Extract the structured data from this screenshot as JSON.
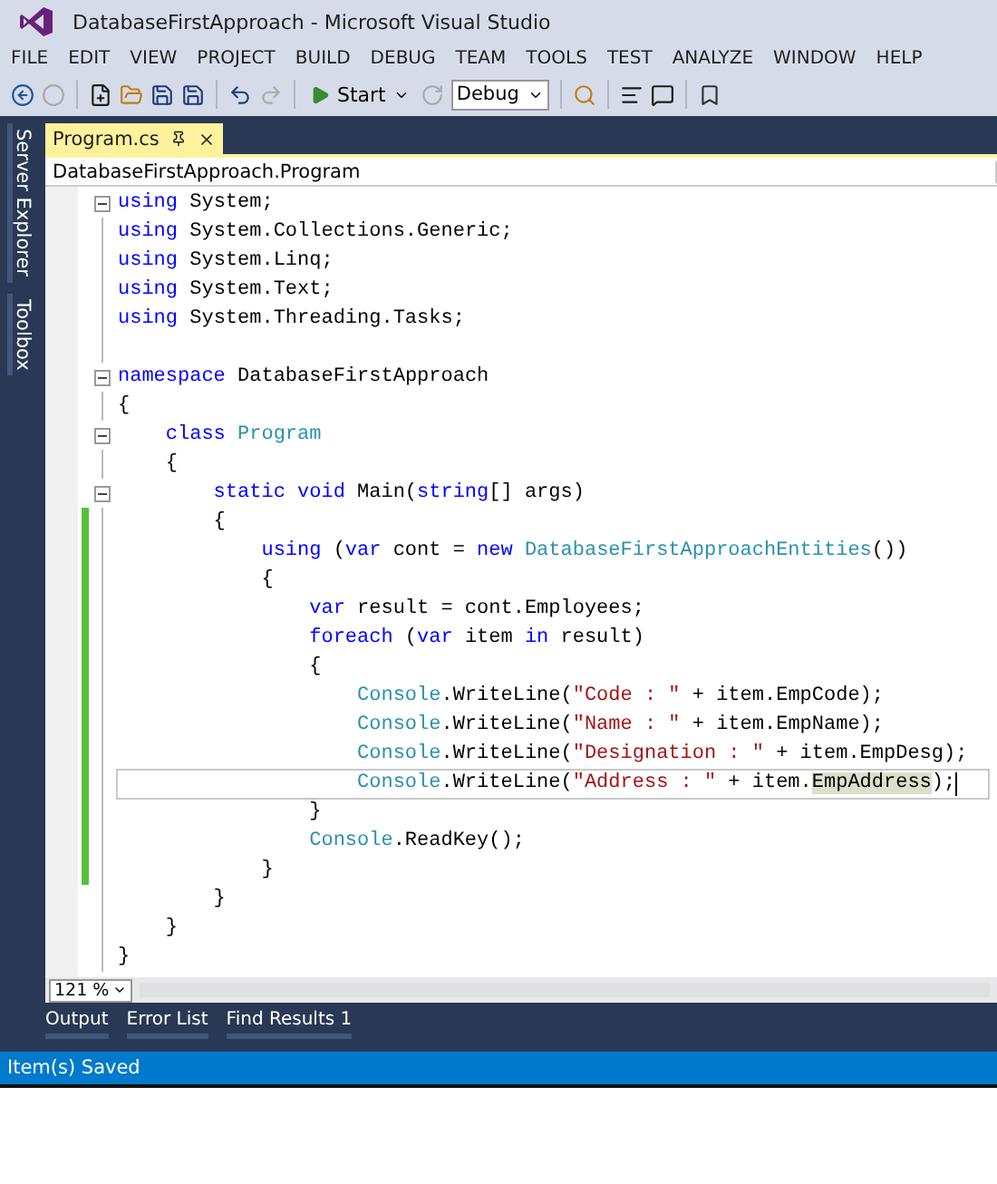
{
  "window": {
    "title": "DatabaseFirstApproach - Microsoft Visual Studio"
  },
  "menu": [
    {
      "label": "FILE"
    },
    {
      "label": "EDIT"
    },
    {
      "label": "VIEW"
    },
    {
      "label": "PROJECT"
    },
    {
      "label": "BUILD"
    },
    {
      "label": "DEBUG"
    },
    {
      "label": "TEAM"
    },
    {
      "label": "TOOLS"
    },
    {
      "label": "TEST"
    },
    {
      "label": "ANALYZE"
    },
    {
      "label": "WINDOW"
    },
    {
      "label": "HELP"
    }
  ],
  "toolbar": {
    "start_label": "Start",
    "configuration": "Debug"
  },
  "side_tabs": [
    {
      "label": "Server Explorer"
    },
    {
      "label": "Toolbox"
    }
  ],
  "document_tabs": [
    {
      "label": "Program.cs",
      "selected": true
    }
  ],
  "navigation": {
    "scope": "DatabaseFirstApproach.Program"
  },
  "code_lines": [
    {
      "fold": true,
      "changed": false,
      "current": false,
      "tokens": [
        {
          "kind": "kw",
          "text": "using"
        },
        {
          "kind": "plain",
          "text": " System;"
        }
      ]
    },
    {
      "fold": false,
      "changed": false,
      "current": false,
      "tokens": [
        {
          "kind": "kw",
          "text": "using"
        },
        {
          "kind": "plain",
          "text": " System.Collections.Generic;"
        }
      ]
    },
    {
      "fold": false,
      "changed": false,
      "current": false,
      "tokens": [
        {
          "kind": "kw",
          "text": "using"
        },
        {
          "kind": "plain",
          "text": " System.Linq;"
        }
      ]
    },
    {
      "fold": false,
      "changed": false,
      "current": false,
      "tokens": [
        {
          "kind": "kw",
          "text": "using"
        },
        {
          "kind": "plain",
          "text": " System.Text;"
        }
      ]
    },
    {
      "fold": false,
      "changed": false,
      "current": false,
      "tokens": [
        {
          "kind": "kw",
          "text": "using"
        },
        {
          "kind": "plain",
          "text": " System.Threading.Tasks;"
        }
      ]
    },
    {
      "fold": false,
      "changed": false,
      "current": false
    },
    {
      "fold": true,
      "changed": false,
      "current": false,
      "tokens": [
        {
          "kind": "kw",
          "text": "namespace"
        },
        {
          "kind": "plain",
          "text": " DatabaseFirstApproach"
        }
      ]
    },
    {
      "fold": false,
      "changed": false,
      "current": false,
      "tokens": [
        {
          "kind": "plain",
          "text": "{"
        }
      ]
    },
    {
      "fold": true,
      "changed": false,
      "current": false,
      "tokens": [
        {
          "kind": "kw",
          "text": "    class"
        },
        {
          "kind": "type",
          "text": " Program"
        }
      ]
    },
    {
      "fold": false,
      "changed": false,
      "current": false,
      "tokens": [
        {
          "kind": "plain",
          "text": "    {"
        }
      ]
    },
    {
      "fold": true,
      "changed": false,
      "current": false,
      "tokens": [
        {
          "kind": "kw",
          "text": "        static void"
        },
        {
          "kind": "plain",
          "text": " Main("
        },
        {
          "kind": "kw",
          "text": "string"
        },
        {
          "kind": "plain",
          "text": "[] args)"
        }
      ]
    },
    {
      "fold": false,
      "changed": true,
      "current": false,
      "tokens": [
        {
          "kind": "plain",
          "text": "        {"
        }
      ]
    },
    {
      "fold": false,
      "changed": true,
      "current": false,
      "tokens": [
        {
          "kind": "kw",
          "text": "            using"
        },
        {
          "kind": "plain",
          "text": " ("
        },
        {
          "kind": "kw",
          "text": "var"
        },
        {
          "kind": "plain",
          "text": " cont = "
        },
        {
          "kind": "kw",
          "text": "new"
        },
        {
          "kind": "type",
          "text": " DatabaseFirstApproachEntities"
        },
        {
          "kind": "plain",
          "text": "())"
        }
      ]
    },
    {
      "fold": false,
      "changed": true,
      "current": false,
      "tokens": [
        {
          "kind": "plain",
          "text": "            {"
        }
      ]
    },
    {
      "fold": false,
      "changed": true,
      "current": false,
      "tokens": [
        {
          "kind": "kw",
          "text": "                var"
        },
        {
          "kind": "plain",
          "text": " result = cont.Employees;"
        }
      ]
    },
    {
      "fold": false,
      "changed": true,
      "current": false,
      "tokens": [
        {
          "kind": "kw",
          "text": "                foreach"
        },
        {
          "kind": "plain",
          "text": " ("
        },
        {
          "kind": "kw",
          "text": "var"
        },
        {
          "kind": "plain",
          "text": " item "
        },
        {
          "kind": "kw",
          "text": "in"
        },
        {
          "kind": "plain",
          "text": " result)"
        }
      ]
    },
    {
      "fold": false,
      "changed": true,
      "current": false,
      "tokens": [
        {
          "kind": "plain",
          "text": "                {"
        }
      ]
    },
    {
      "fold": false,
      "changed": true,
      "current": false,
      "tokens": [
        {
          "kind": "type",
          "text": "                    Console"
        },
        {
          "kind": "plain",
          "text": ".WriteLine("
        },
        {
          "kind": "str",
          "text": "\"Code : \""
        },
        {
          "kind": "plain",
          "text": " + item.EmpCode);"
        }
      ]
    },
    {
      "fold": false,
      "changed": true,
      "current": false,
      "tokens": [
        {
          "kind": "type",
          "text": "                    Console"
        },
        {
          "kind": "plain",
          "text": ".WriteLine("
        },
        {
          "kind": "str",
          "text": "\"Name : \""
        },
        {
          "kind": "plain",
          "text": " + item.EmpName);"
        }
      ]
    },
    {
      "fold": false,
      "changed": true,
      "current": false,
      "tokens": [
        {
          "kind": "type",
          "text": "                    Console"
        },
        {
          "kind": "plain",
          "text": ".WriteLine("
        },
        {
          "kind": "str",
          "text": "\"Designation : \""
        },
        {
          "kind": "plain",
          "text": " + item.EmpDesg);"
        }
      ]
    },
    {
      "fold": false,
      "changed": true,
      "current": true,
      "tokens": [
        {
          "kind": "type",
          "text": "                    Console"
        },
        {
          "kind": "plain",
          "text": ".WriteLine("
        },
        {
          "kind": "str",
          "text": "\"Address : \""
        },
        {
          "kind": "plain",
          "text": " + item."
        },
        {
          "kind": "ref",
          "text": "EmpAddress"
        },
        {
          "kind": "plain",
          "text": ");"
        }
      ]
    },
    {
      "fold": false,
      "changed": true,
      "current": false,
      "tokens": [
        {
          "kind": "plain",
          "text": "                }"
        }
      ]
    },
    {
      "fold": false,
      "changed": true,
      "current": false,
      "tokens": [
        {
          "kind": "type",
          "text": "                Console"
        },
        {
          "kind": "plain",
          "text": ".ReadKey();"
        }
      ]
    },
    {
      "fold": false,
      "changed": true,
      "current": false,
      "tokens": [
        {
          "kind": "plain",
          "text": "            }"
        }
      ]
    },
    {
      "fold": false,
      "changed": false,
      "current": false,
      "tokens": [
        {
          "kind": "plain",
          "text": "        }"
        }
      ]
    },
    {
      "fold": false,
      "changed": false,
      "current": false,
      "tokens": [
        {
          "kind": "plain",
          "text": "    }"
        }
      ]
    },
    {
      "fold": false,
      "changed": false,
      "current": false,
      "tokens": [
        {
          "kind": "plain",
          "text": "}"
        }
      ]
    }
  ],
  "zoom": "121 %",
  "bottom_tabs": [
    {
      "label": "Output"
    },
    {
      "label": "Error List"
    },
    {
      "label": "Find Results 1"
    }
  ],
  "status_bar": {
    "text": "Item(s) Saved"
  }
}
